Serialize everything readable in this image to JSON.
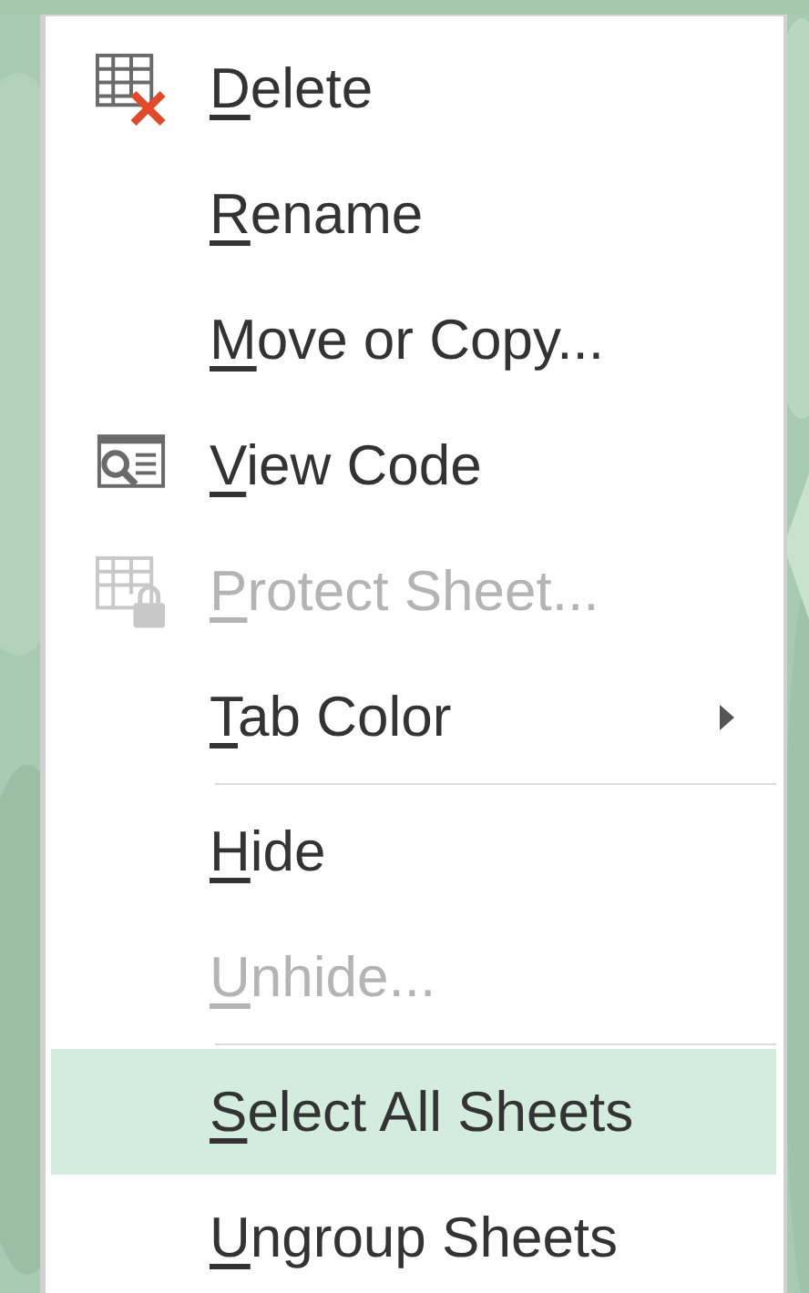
{
  "menu": {
    "items": [
      {
        "kind": "command",
        "label": "Delete",
        "disabled": false,
        "selected": false,
        "has_submenu": false
      },
      {
        "kind": "command",
        "label": "Rename",
        "disabled": false,
        "selected": false,
        "has_submenu": false
      },
      {
        "kind": "command",
        "label": "Move or Copy...",
        "disabled": false,
        "selected": false,
        "has_submenu": false
      },
      {
        "kind": "command",
        "label": "View Code",
        "disabled": false,
        "selected": false,
        "has_submenu": false
      },
      {
        "kind": "command",
        "label": "Protect Sheet...",
        "disabled": true,
        "selected": false,
        "has_submenu": false
      },
      {
        "kind": "command",
        "label": "Tab Color",
        "disabled": false,
        "selected": false,
        "has_submenu": true
      },
      {
        "kind": "separator"
      },
      {
        "kind": "command",
        "label": "Hide",
        "disabled": false,
        "selected": false,
        "has_submenu": false
      },
      {
        "kind": "command",
        "label": "Unhide...",
        "disabled": true,
        "selected": false,
        "has_submenu": false
      },
      {
        "kind": "separator"
      },
      {
        "kind": "command",
        "label": "Select All Sheets",
        "disabled": false,
        "selected": true,
        "has_submenu": false
      },
      {
        "kind": "command",
        "label": "Ungroup Sheets",
        "disabled": false,
        "selected": false,
        "has_submenu": false
      }
    ]
  }
}
